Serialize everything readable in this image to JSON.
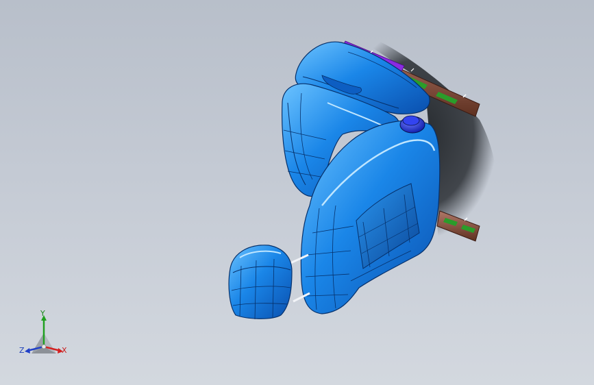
{
  "viewport": {
    "background_top": "#b8bfca",
    "background_bottom": "#d3d8df"
  },
  "model": {
    "name": "seat-assembly",
    "parts": [
      "headrest",
      "seat-back",
      "seat-cushion",
      "armrest",
      "slide-rail-upper",
      "slide-rail-lower",
      "adjuster-knob",
      "armrest-pins"
    ],
    "colors": {
      "seat": "#1a86e8",
      "seat_edge": "#06306a",
      "knob": "#1b2fd8",
      "rail": "#8a5040",
      "rail_accent": "#8a2be2",
      "rail_clip": "#2a9d2a"
    }
  },
  "triad": {
    "x_label": "X",
    "y_label": "Y",
    "z_label": "Z",
    "colors": {
      "x": "#d42020",
      "y": "#20a020",
      "z": "#2040c8"
    }
  }
}
